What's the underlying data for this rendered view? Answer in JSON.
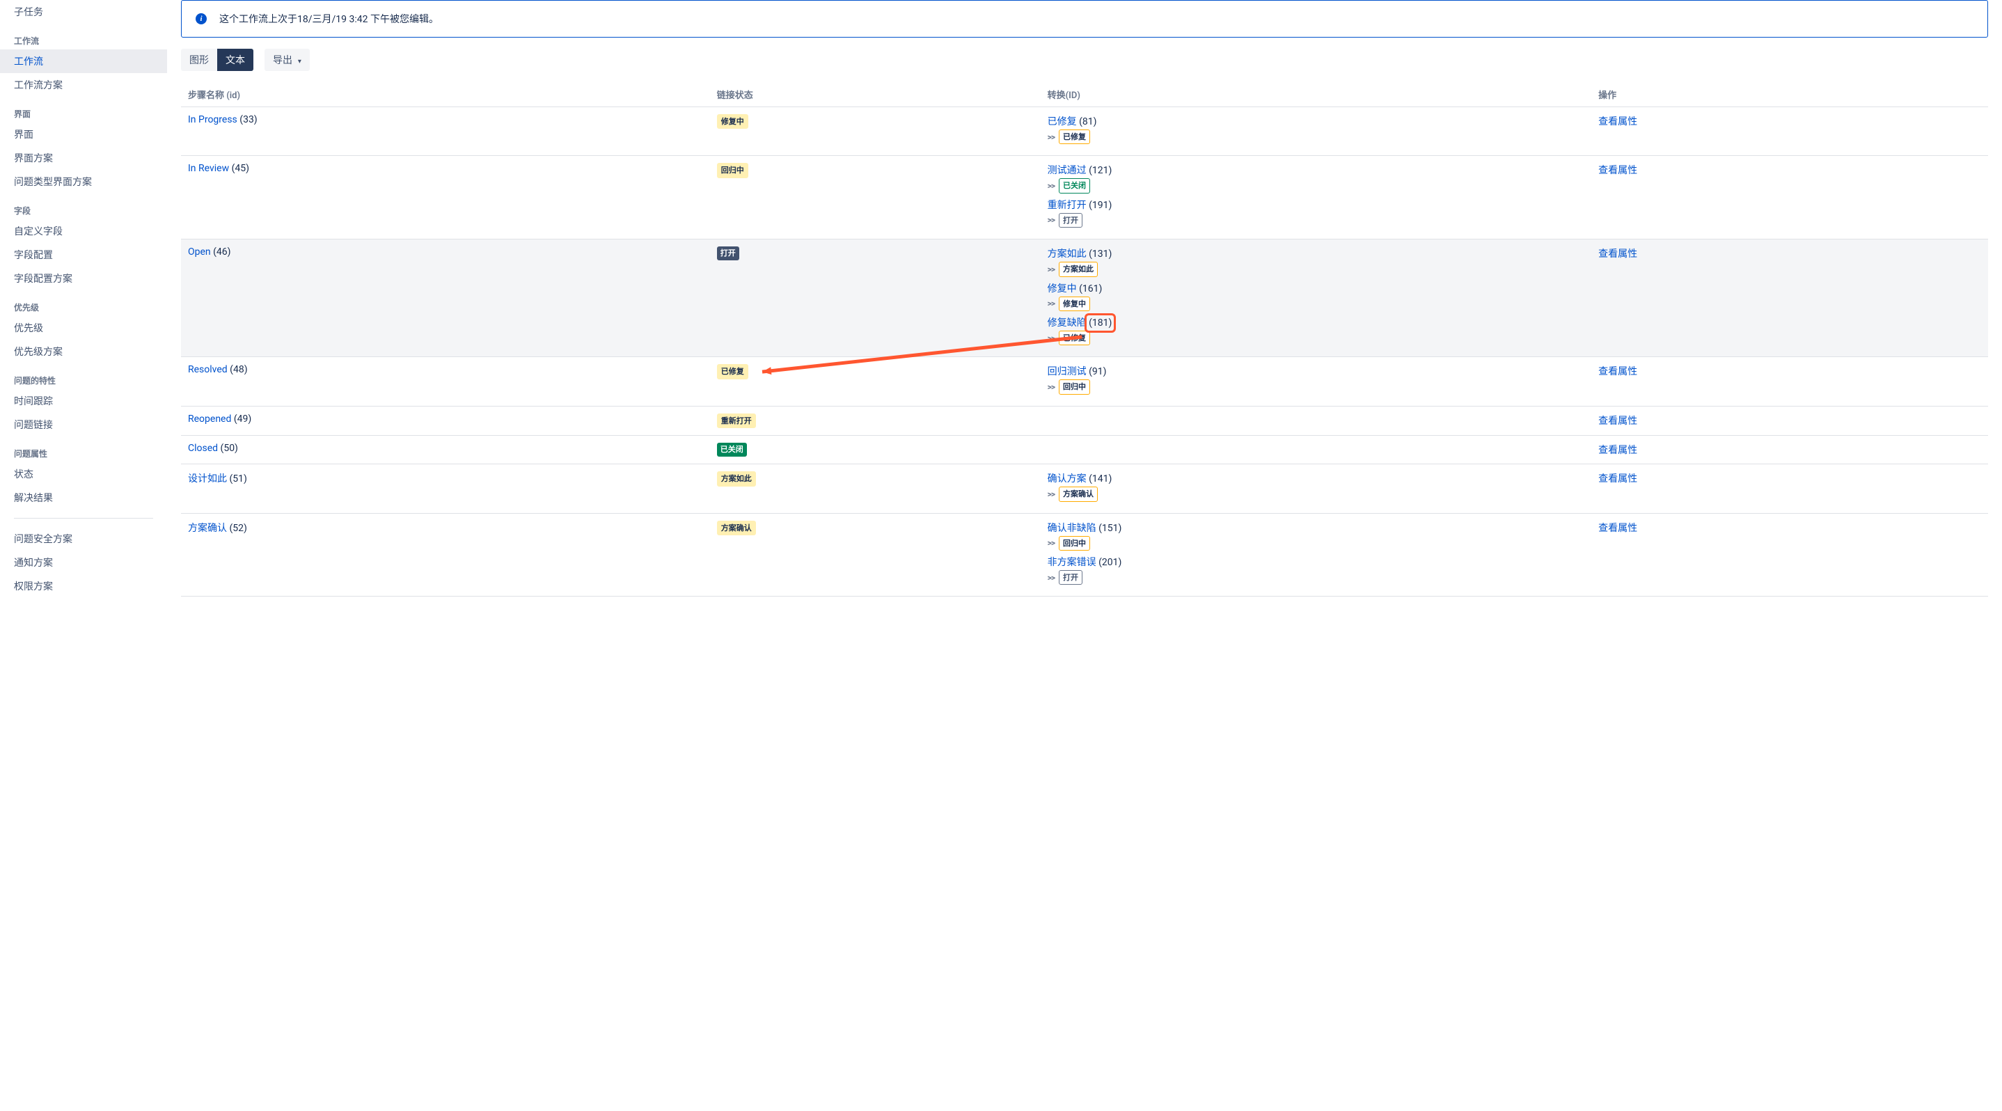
{
  "sidebar": {
    "items_top": [
      {
        "label": "子任务"
      }
    ],
    "section_workflow": {
      "heading": "工作流",
      "items": [
        {
          "label": "工作流",
          "active": true
        },
        {
          "label": "工作流方案"
        }
      ]
    },
    "section_screen": {
      "heading": "界面",
      "items": [
        {
          "label": "界面"
        },
        {
          "label": "界面方案"
        },
        {
          "label": "问题类型界面方案"
        }
      ]
    },
    "section_field": {
      "heading": "字段",
      "items": [
        {
          "label": "自定义字段"
        },
        {
          "label": "字段配置"
        },
        {
          "label": "字段配置方案"
        }
      ]
    },
    "section_priority": {
      "heading": "优先级",
      "items": [
        {
          "label": "优先级"
        },
        {
          "label": "优先级方案"
        }
      ]
    },
    "section_issuefeat": {
      "heading": "问题的特性",
      "items": [
        {
          "label": "时间跟踪"
        },
        {
          "label": "问题链接"
        }
      ]
    },
    "section_issueattr": {
      "heading": "问题属性",
      "items": [
        {
          "label": "状态"
        },
        {
          "label": "解决结果"
        }
      ]
    },
    "items_bottom": [
      {
        "label": "问题安全方案"
      },
      {
        "label": "通知方案"
      },
      {
        "label": "权限方案"
      }
    ]
  },
  "info": {
    "text": "这个工作流上次于18/三月/19 3:42 下午被您编辑。"
  },
  "toolbar": {
    "diagram": "图形",
    "text": "文本",
    "export": "导出"
  },
  "table": {
    "headers": {
      "step": "步骤名称 (id)",
      "status": "链接状态",
      "transitions": "转换(ID)",
      "ops": "操作"
    },
    "ops_view": "查看属性",
    "arrow": ">>",
    "rows": [
      {
        "step": "In Progress",
        "id": "(33)",
        "status": {
          "text": "修复中",
          "cls": "loz-yellow"
        },
        "transitions": [
          {
            "name": "已修复",
            "id": "(81)",
            "dest": {
              "text": "已修复",
              "cls": "loz-outline-yellow"
            }
          }
        ]
      },
      {
        "step": "In Review",
        "id": "(45)",
        "status": {
          "text": "回归中",
          "cls": "loz-yellow"
        },
        "transitions": [
          {
            "name": "测试通过",
            "id": "(121)",
            "dest": {
              "text": "已关闭",
              "cls": "loz-outline-green"
            }
          },
          {
            "name": "重新打开",
            "id": "(191)",
            "dest": {
              "text": "打开",
              "cls": "loz-outline-gray"
            }
          }
        ]
      },
      {
        "highlight": true,
        "step": "Open",
        "id": "(46)",
        "status": {
          "text": "打开",
          "cls": "loz-gray"
        },
        "transitions": [
          {
            "name": "方案如此",
            "id": "(131)",
            "dest": {
              "text": "方案如此",
              "cls": "loz-outline-yellow"
            }
          },
          {
            "name": "修复中",
            "id": "(161)",
            "dest": {
              "text": "修复中",
              "cls": "loz-outline-yellow"
            }
          },
          {
            "name": "修复缺陷",
            "id": "(181)",
            "dest": {
              "text": "已修复",
              "cls": "loz-outline-yellow"
            },
            "annot": true
          }
        ]
      },
      {
        "step": "Resolved",
        "id": "(48)",
        "status": {
          "text": "已修复",
          "cls": "loz-yellow"
        },
        "transitions": [
          {
            "name": "回归测试",
            "id": "(91)",
            "dest": {
              "text": "回归中",
              "cls": "loz-outline-yellow"
            }
          }
        ]
      },
      {
        "step": "Reopened",
        "id": "(49)",
        "status": {
          "text": "重新打开",
          "cls": "loz-yellow"
        },
        "transitions": []
      },
      {
        "step": "Closed",
        "id": "(50)",
        "status": {
          "text": "已关闭",
          "cls": "loz-green"
        },
        "transitions": []
      },
      {
        "step": "设计如此",
        "id": "(51)",
        "status": {
          "text": "方案如此",
          "cls": "loz-yellow"
        },
        "transitions": [
          {
            "name": "确认方案",
            "id": "(141)",
            "dest": {
              "text": "方案确认",
              "cls": "loz-outline-yellow"
            }
          }
        ]
      },
      {
        "step": "方案确认",
        "id": "(52)",
        "status": {
          "text": "方案确认",
          "cls": "loz-yellow"
        },
        "transitions": [
          {
            "name": "确认非缺陷",
            "id": "(151)",
            "dest": {
              "text": "回归中",
              "cls": "loz-outline-yellow"
            }
          },
          {
            "name": "非方案错误",
            "id": "(201)",
            "dest": {
              "text": "打开",
              "cls": "loz-outline-gray"
            }
          }
        ]
      }
    ]
  }
}
